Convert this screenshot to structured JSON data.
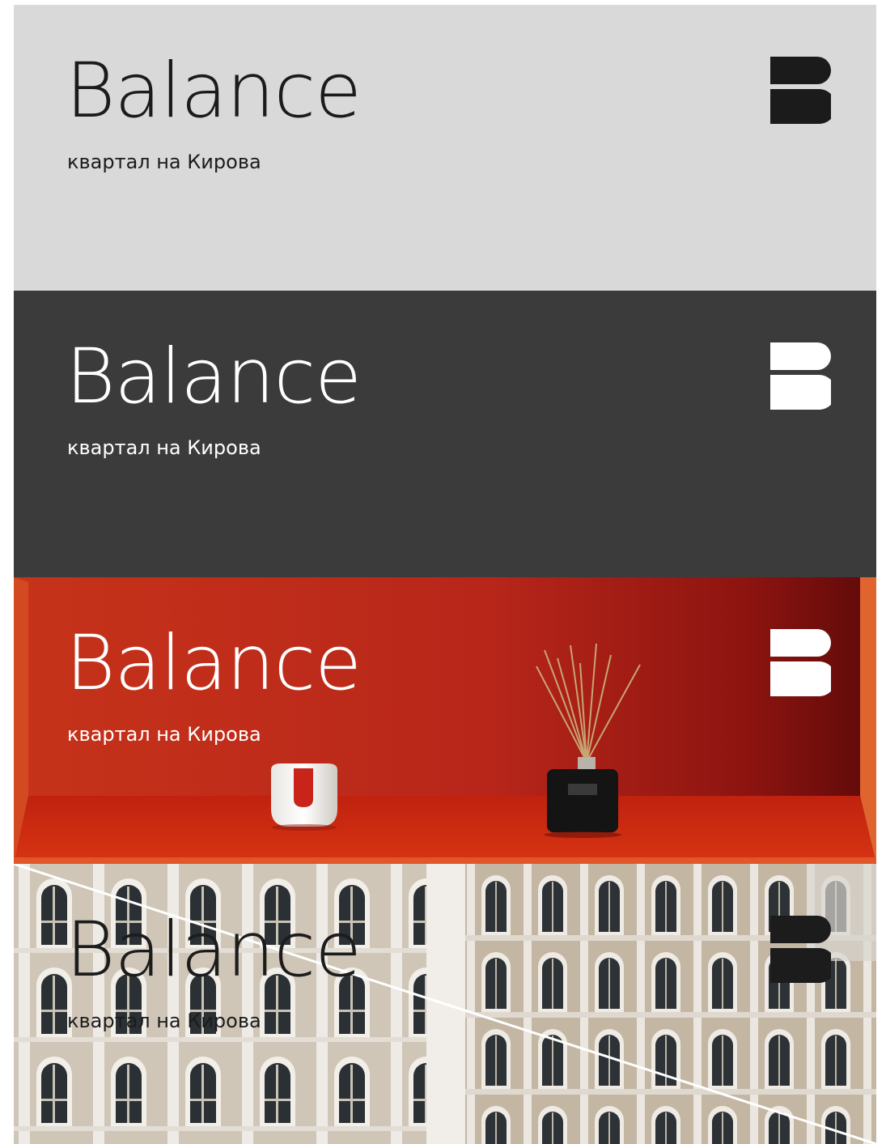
{
  "brand": {
    "name": "Balance",
    "tagline": "квартал на Кирова"
  },
  "variants": [
    {
      "id": "light",
      "background": "#d9d9d9",
      "text_color": "#1b1b1b"
    },
    {
      "id": "dark",
      "background": "#3b3b3b",
      "text_color": "#ffffff"
    },
    {
      "id": "red-photo",
      "background": "#b92b16",
      "text_color": "#ffffff",
      "photo": "red shelf with white vase and reed diffuser"
    },
    {
      "id": "building-photo",
      "background": "#d8d1c6",
      "text_color": "#1c1c1c",
      "photo": "beige building facade with arched windows"
    }
  ],
  "icons": [
    "b-logo-mark"
  ]
}
